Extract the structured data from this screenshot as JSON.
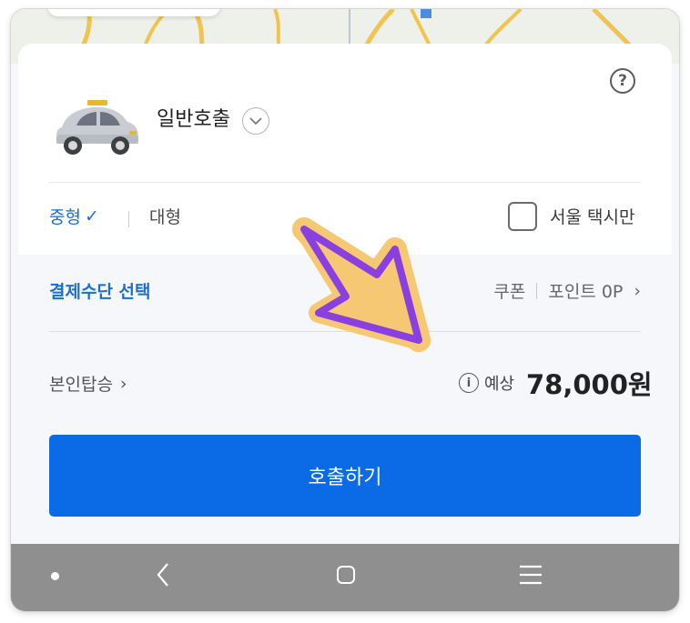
{
  "colors": {
    "accent_blue": "#1a6fd1",
    "button_blue": "#0b6ae6",
    "arrow_fill": "#f7c873",
    "arrow_stroke": "#8a3fe0",
    "nav_bar": "#8f8f8f"
  },
  "help_icon_glyph": "?",
  "service": {
    "title": "일반호출"
  },
  "taxi_size": {
    "mid": "중형",
    "mid_check": "✓",
    "large": "대형"
  },
  "seoul_only": {
    "label": "서울 택시만",
    "checked": false
  },
  "payment": {
    "label": "결제수단 선택",
    "coupon": "쿠폰",
    "points": "포인트 0P",
    "chevron": "›"
  },
  "self_ride": {
    "label": "본인탑승",
    "chevron": "›"
  },
  "fare": {
    "info_glyph": "i",
    "label": "예상",
    "amount": "78,000원"
  },
  "call_button": {
    "label": "호출하기"
  },
  "icons": [
    "help-icon",
    "taxi-icon",
    "chevron-down-icon",
    "check-icon",
    "checkbox-icon",
    "chevron-right-icon",
    "info-icon",
    "back-icon",
    "home-icon",
    "recent-apps-icon",
    "annotation-arrow"
  ]
}
